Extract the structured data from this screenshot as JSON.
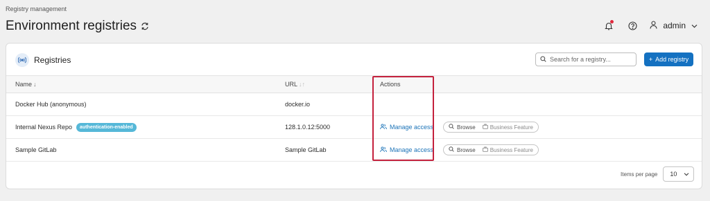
{
  "breadcrumb": "Registry management",
  "page": {
    "title": "Environment registries"
  },
  "user": {
    "name": "admin"
  },
  "panel": {
    "title": "Registries",
    "search_placeholder": "Search for a registry...",
    "add_button": "Add registry"
  },
  "table": {
    "columns": {
      "name": "Name",
      "url": "URL",
      "actions": "Actions"
    },
    "rows": [
      {
        "name": "Docker Hub (anonymous)",
        "badge": "",
        "url": "docker.io",
        "manage": "",
        "browse": "",
        "business": ""
      },
      {
        "name": "Internal Nexus Repo",
        "badge": "authentication-enabled",
        "url": "128.1.0.12:5000",
        "manage": "Manage access",
        "browse": "Browse",
        "business": "Business Feature"
      },
      {
        "name": "Sample GitLab",
        "badge": "",
        "url": "Sample GitLab",
        "manage": "Manage access",
        "browse": "Browse",
        "business": "Business Feature"
      }
    ]
  },
  "pagination": {
    "label": "Items per page",
    "value": "10"
  },
  "colors": {
    "accent": "#1471c1",
    "badge": "#56b8d8",
    "highlight": "#c4203c",
    "notification": "#e0283c"
  }
}
